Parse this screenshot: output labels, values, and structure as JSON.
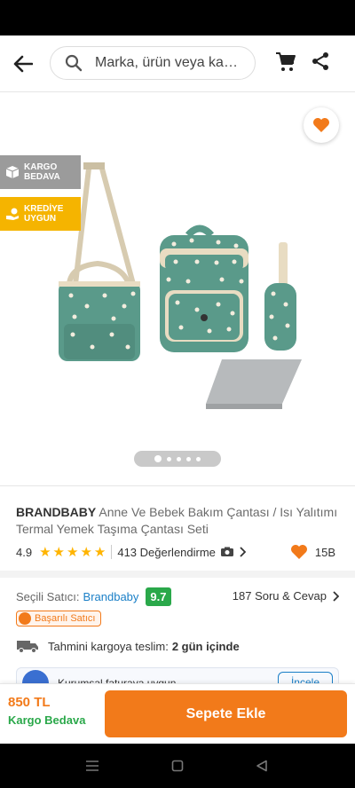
{
  "search": {
    "placeholder": "Marka, ürün veya kate…"
  },
  "gallery": {
    "badge_cargo": [
      "KARGO",
      "BEDAVA"
    ],
    "badge_credit": [
      "KREDİYE",
      "UYGUN"
    ],
    "image_count": 5,
    "active_index": 0,
    "colors": {
      "bag": "#5a9a8a",
      "trim": "#e8dcc2",
      "mat": "#b7babc"
    }
  },
  "product": {
    "brand": "BRANDBABY",
    "name": "Anne Ve Bebek Bakım Çantası / Isı Yalıtımı Termal Yemek Taşıma Çantası Seti",
    "rating": "4.9",
    "stars": 5,
    "reviews": "413 Değerlendirme",
    "favorites": "15B"
  },
  "seller": {
    "label": "Seçili Satıcı:",
    "name": "Brandbaby",
    "score": "9.7",
    "qa": "187 Soru & Cevap",
    "badge": "Başarılı Satıcı"
  },
  "delivery": {
    "label": "Tahmini kargoya teslim:",
    "value": "2 gün içinde"
  },
  "invoice": {
    "text": "Kurumsal faturaya uygun",
    "button": "İncele"
  },
  "bottom": {
    "price": "850 TL",
    "cargo": "Kargo Bedava",
    "add_to_cart": "Sepete Ekle"
  },
  "colors": {
    "accent": "#f27a1a",
    "green": "#2aa84a",
    "link": "#1a7fc7"
  }
}
